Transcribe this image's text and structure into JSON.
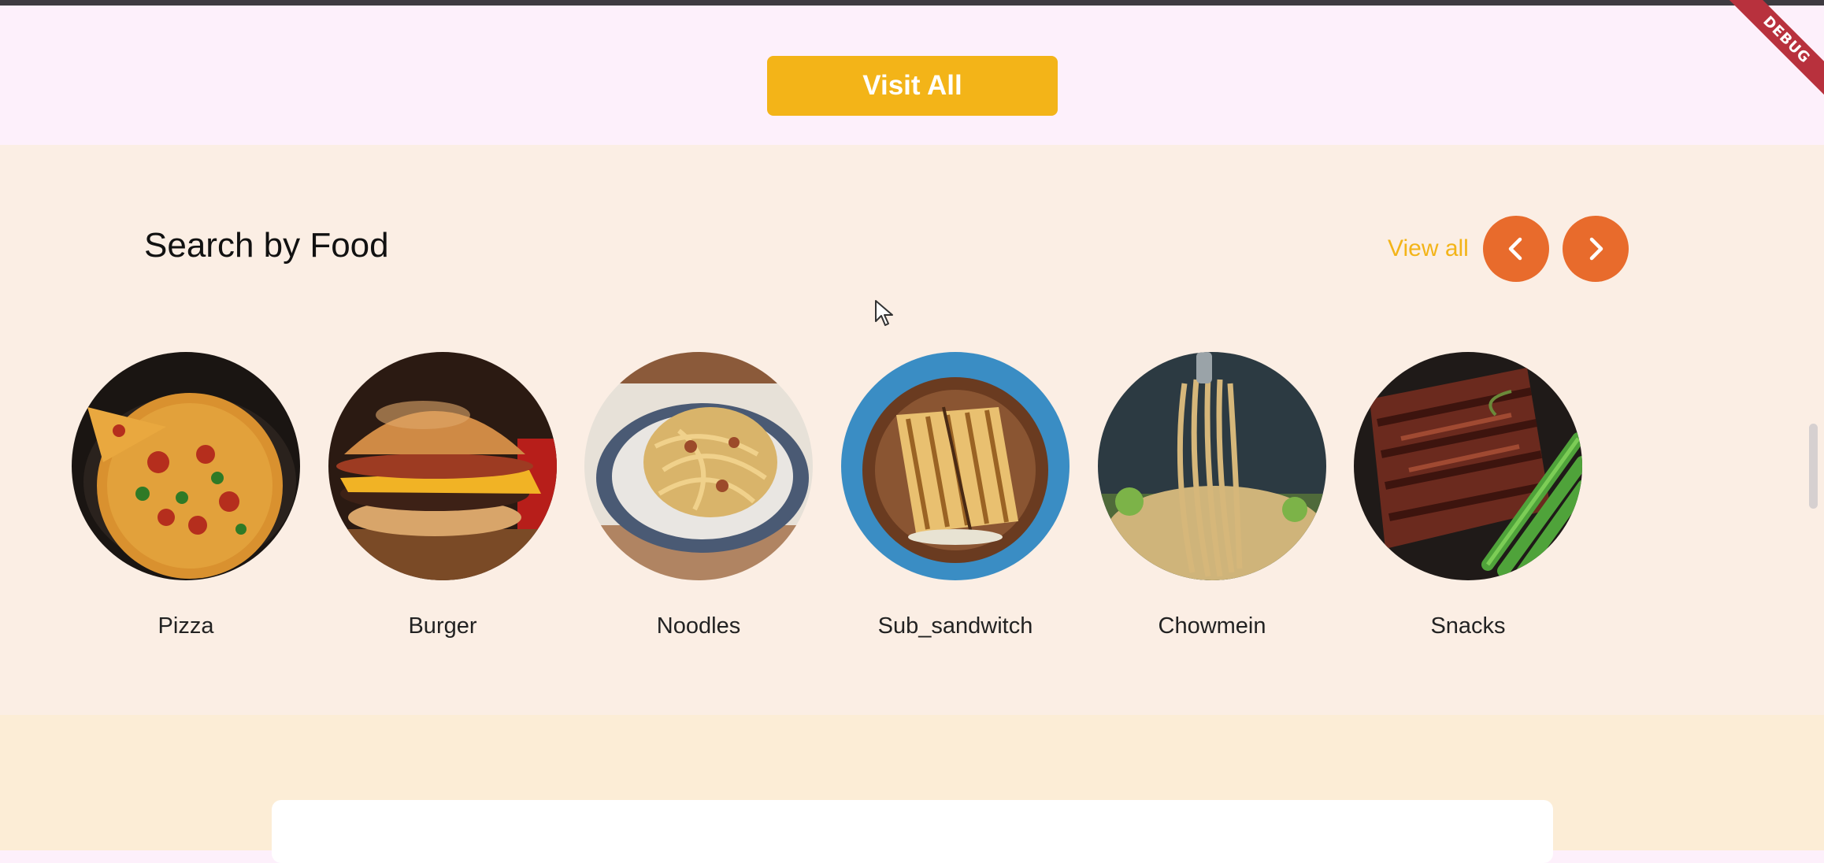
{
  "debug_banner": "DEBUG",
  "top_section": {
    "visit_all_label": "Visit All"
  },
  "food_section": {
    "title": "Search by Food",
    "view_all_label": "View all",
    "items": [
      {
        "label": "Pizza"
      },
      {
        "label": "Burger"
      },
      {
        "label": "Noodles"
      },
      {
        "label": "Sub_sandwitch"
      },
      {
        "label": "Chowmein"
      },
      {
        "label": "Snacks"
      }
    ]
  },
  "colors": {
    "accent_yellow": "#f3b418",
    "accent_orange": "#e86b2c",
    "top_bg": "#fdf0fb",
    "food_bg": "#fbeee4",
    "bottom_bg": "#fcedd6"
  },
  "icons": {
    "prev": "chevron-left-icon",
    "next": "chevron-right-icon",
    "cursor": "mouse-pointer-icon"
  }
}
